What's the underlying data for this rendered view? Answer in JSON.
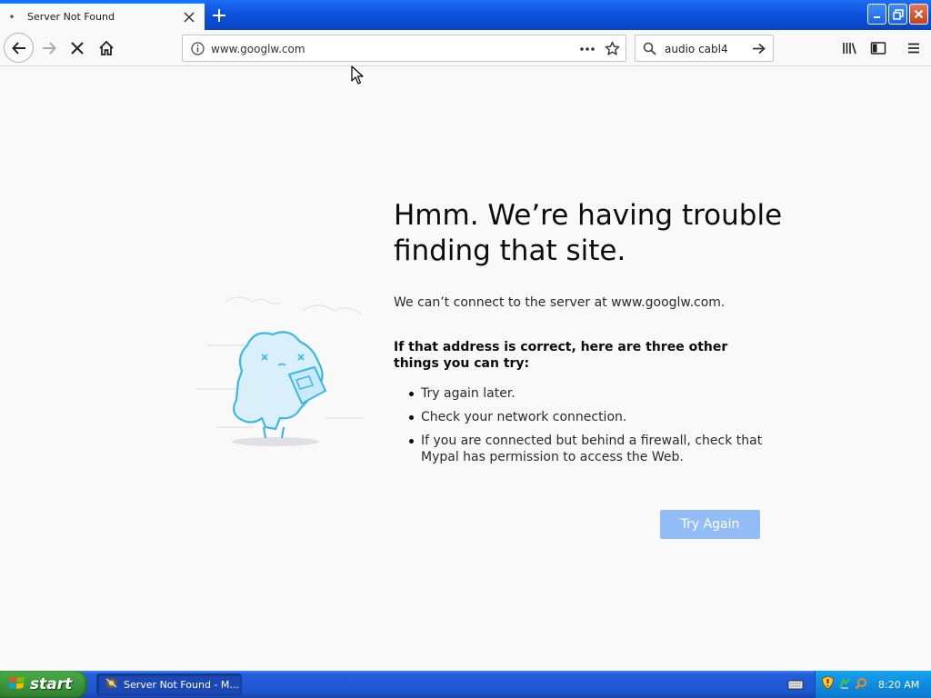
{
  "tab": {
    "title": "Server Not Found",
    "favicon": "•"
  },
  "navbar": {
    "url": "www.googlw.com",
    "search_value": "audio cabl4"
  },
  "error": {
    "title": "Hmm. We’re having trouble finding that site.",
    "description": "We can’t connect to the server at www.googlw.com.",
    "suggestions_heading": "If that address is correct, here are three other things you can try:",
    "suggestions": [
      "Try again later.",
      "Check your network connection.",
      "If you are connected but behind a firewall, check that Mypal has permission to access the Web."
    ],
    "try_again_label": "Try Again"
  },
  "taskbar": {
    "start_label": "start",
    "task_label": "Server Not Found - M...",
    "clock": "8:20 AM"
  },
  "colors": {
    "accent": "#0a84ff",
    "button_disabled": "#93bdf6",
    "taskbar": "#245edb",
    "start": "#3b963b"
  }
}
